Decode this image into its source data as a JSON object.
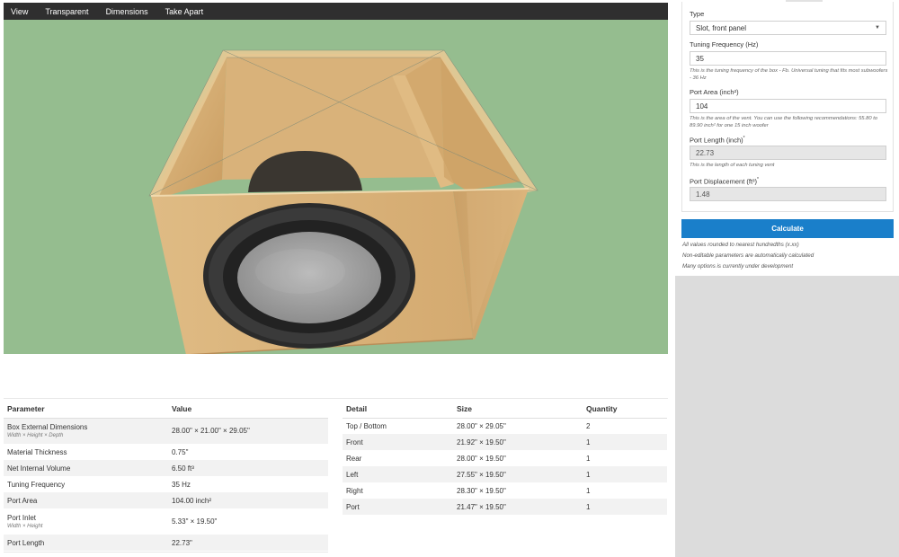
{
  "menu": {
    "items": [
      "View",
      "Transparent",
      "Dimensions",
      "Take Apart"
    ]
  },
  "parameters": {
    "headers": [
      "Parameter",
      "Value"
    ],
    "rows": [
      {
        "name": "Box External Dimensions",
        "sub": "Width × Height × Depth",
        "value": "28.00\" × 21.00\" × 29.05\""
      },
      {
        "name": "Material Thickness",
        "sub": "",
        "value": "0.75\""
      },
      {
        "name": "Net Internal Volume",
        "sub": "",
        "value": "6.50 ft³"
      },
      {
        "name": "Tuning Frequency",
        "sub": "",
        "value": "35 Hz"
      },
      {
        "name": "Port Area",
        "sub": "",
        "value": "104.00 inch²"
      },
      {
        "name": "Port Inlet",
        "sub": "Width × Height",
        "value": "5.33\" × 19.50\""
      },
      {
        "name": "Port Length",
        "sub": "",
        "value": "22.73\""
      }
    ]
  },
  "details": {
    "headers": [
      "Detail",
      "Size",
      "Quantity"
    ],
    "rows": [
      {
        "detail": "Top / Bottom",
        "size": "28.00\" × 29.05\"",
        "qty": "2"
      },
      {
        "detail": "Front",
        "size": "21.92\" × 19.50\"",
        "qty": "1"
      },
      {
        "detail": "Rear",
        "size": "28.00\" × 19.50\"",
        "qty": "1"
      },
      {
        "detail": "Left",
        "size": "27.55\" × 19.50\"",
        "qty": "1"
      },
      {
        "detail": "Right",
        "size": "28.30\" × 19.50\"",
        "qty": "1"
      },
      {
        "detail": "Port",
        "size": "21.47\" × 19.50\"",
        "qty": "1"
      }
    ]
  },
  "form": {
    "type_label": "Type",
    "type_value": "Slot, front panel",
    "tuning_label": "Tuning Frequency (Hz)",
    "tuning_value": "35",
    "tuning_hint": "This is the tuning frequency of the box - Fb. Universal tuning that fits most subwoofers - 36 Hz",
    "port_area_label": "Port Area (inch²)",
    "port_area_value": "104",
    "port_area_hint": "This is the area of the vent. You can use the following recommendations: 55.80 to 89.90 inch² for one 15 inch woofer",
    "port_length_label": "Port Length (inch)",
    "port_length_mark": "*",
    "port_length_value": "22.73",
    "port_length_hint": "This is the length of each tuning vent",
    "port_disp_label": "Port Displacement (ft³)",
    "port_disp_mark": "*",
    "port_disp_value": "1.48"
  },
  "calculate_label": "Calculate",
  "notes": [
    "All values rounded to nearest hundredths (x.xx)",
    "Non-editable parameters are automatically calculated",
    "Many options is currently under development"
  ],
  "colors": {
    "viewer_bg": "#95bd8f",
    "menubar": "#2f2f2f",
    "accent": "#1a7fca",
    "wood": "#d9b27a"
  }
}
